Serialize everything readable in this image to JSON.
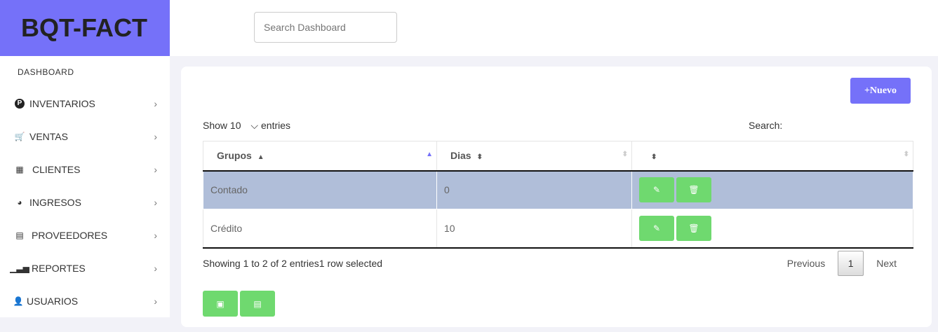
{
  "brand": "BQT-FACT",
  "search": {
    "placeholder": "Search Dashboard"
  },
  "sidebar": {
    "heading": "DASHBOARD",
    "items": [
      {
        "label": "INVENTARIOS",
        "icon": "parking-circle-icon"
      },
      {
        "label": "VENTAS",
        "icon": "cart-icon"
      },
      {
        "label": "CLIENTES",
        "icon": "cubes-icon"
      },
      {
        "label": "INGRESOS",
        "icon": "tachometer-icon"
      },
      {
        "label": "PROVEEDORES",
        "icon": "id-card-icon"
      },
      {
        "label": "REPORTES",
        "icon": "bar-chart-icon"
      },
      {
        "label": "USUARIOS",
        "icon": "user-icon"
      }
    ]
  },
  "main": {
    "nuevo": "+Nuevo",
    "show": "Show",
    "page_size": "10",
    "entries": "entries",
    "search_label": "Search:",
    "columns": [
      "Grupos",
      "Dias",
      ""
    ],
    "rows": [
      {
        "grupo": "Contado",
        "dias": "0"
      },
      {
        "grupo": "Crédito",
        "dias": "10"
      }
    ],
    "info": "Showing 1 to 2 of 2 entries1 row selected",
    "pagination": {
      "previous": "Previous",
      "current": "1",
      "next": "Next"
    }
  },
  "colors": {
    "brand": "#7571f9",
    "action": "#6fd96f",
    "selected_row": "#b0bed9"
  }
}
